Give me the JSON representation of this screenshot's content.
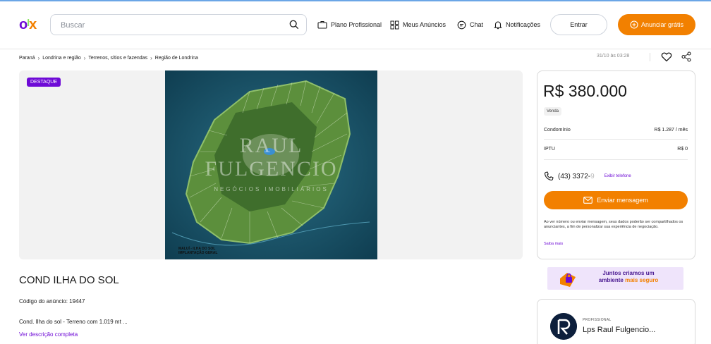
{
  "header": {
    "logo_text": "OLX",
    "search_placeholder": "Buscar",
    "nav": [
      "Plano Profissional",
      "Meus Anúncios",
      "Chat",
      "Notificações"
    ],
    "login_label": "Entrar",
    "post_ad_label": "Anunciar grátis",
    "colors": {
      "brand_purple": "#6e0ad6",
      "brand_orange": "#f28000",
      "brand_green": "#8ce563"
    }
  },
  "breadcrumb": [
    "Paraná",
    "Londrina e região",
    "Terrenos, sítios e fazendas",
    "Região de Londrina"
  ],
  "post_date": "31/10 às 03:28",
  "gallery": {
    "badge": "DESTAQUE",
    "watermark_line1": "RAUL",
    "watermark_line2": "FULGENCIO",
    "watermark_line3": "NEGÓCIOS IMOBILIÁRIOS",
    "image_caption_line1": "MALUÍ - ILHA DO SOL",
    "image_caption_line2": "IMPLANTAÇÃO GERAL"
  },
  "listing": {
    "title": "COND ILHA DO SOL",
    "code": "Código do anúncio: 19447",
    "description": "Cond. Ilha do sol - Terreno com 1.019 mt ...",
    "more_link": "Ver descrição completa"
  },
  "price_box": {
    "price": "R$ 380.000",
    "type": "Venda",
    "condo_label": "Condomínio",
    "condo_value": "R$ 1.287 / mês",
    "iptu_label": "IPTU",
    "iptu_value": "R$ 0",
    "phone": "(43) 3372-",
    "phone_mask": "9",
    "show_phone": "Exibir telefone",
    "send_message": "Enviar mensagem",
    "disclaimer": "Ao ver número ou enviar mensagem, seus dados poderão ser compartilhados os anunciantes, a fim de personalizar sua experiência de negociação.",
    "learn_more": "Saiba mais"
  },
  "banner": {
    "line1": "Juntos criamos um",
    "line2a": "ambiente ",
    "line2b": "mais seguro"
  },
  "seller": {
    "label": "PROFISSIONAL",
    "name": "Lps Raul Fulgencio..."
  }
}
